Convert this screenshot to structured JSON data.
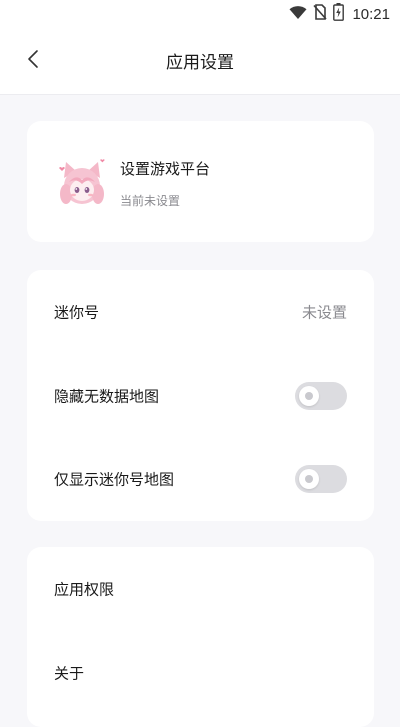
{
  "status_bar": {
    "time": "10:21",
    "icons": [
      "wifi-icon",
      "no-sim-icon",
      "battery-charging-icon"
    ]
  },
  "header": {
    "title": "应用设置",
    "back_icon": "chevron-left-icon"
  },
  "platform_card": {
    "title": "设置游戏平台",
    "subtitle": "当前未设置",
    "avatar": "anime-avatar-image"
  },
  "settings": {
    "mini_id": {
      "label": "迷你号",
      "value": "未设置"
    },
    "hide_no_data_map": {
      "label": "隐藏无数据地图",
      "enabled": false
    },
    "only_show_mini_map": {
      "label": "仅显示迷你号地图",
      "enabled": false
    }
  },
  "about_card": {
    "permissions_label": "应用权限",
    "about_label": "关于"
  },
  "colors": {
    "background": "#f7f7fa",
    "card": "#ffffff",
    "toggle_off": "#dcdce0",
    "secondary_text": "#8a8a8f"
  }
}
